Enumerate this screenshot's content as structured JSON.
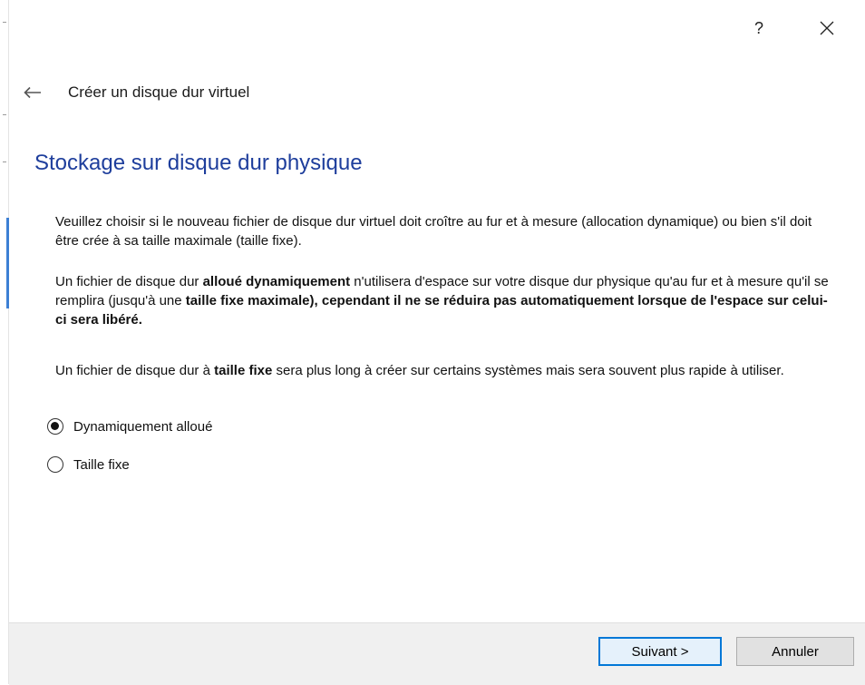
{
  "titlebar": {
    "help": "?",
    "close": "✕"
  },
  "wizard": {
    "title": "Créer un disque dur virtuel"
  },
  "page": {
    "title": "Stockage sur disque dur physique",
    "paragraph1": "Veuillez choisir si le nouveau fichier de disque dur virtuel doit croître au fur et à mesure (allocation dynamique) ou bien s'il doit être crée à sa taille maximale (taille fixe).",
    "paragraph2": {
      "part1": "Un fichier de disque dur ",
      "bold1": "alloué dynamiquement",
      "part2": " n'utilisera d'espace sur votre disque dur physique qu'au fur et à mesure qu'il se remplira (jusqu'à une ",
      "bold2": "taille fixe maximale), cependant il ne se réduira pas automatiquement lorsque de l'espace sur celui-ci sera libéré."
    },
    "paragraph3": {
      "part1": "Un fichier de disque dur à ",
      "bold1": "taille fixe",
      "part2": " sera plus long à créer sur certains systèmes mais sera souvent plus rapide à utiliser."
    }
  },
  "options": [
    {
      "label": "Dynamiquement alloué",
      "checked": true
    },
    {
      "label": "Taille fixe",
      "checked": false
    }
  ],
  "buttons": {
    "next": "Suivant >",
    "cancel": "Annuler"
  },
  "colors": {
    "title": "#1e3e9c",
    "accent": "#0078d7",
    "footer": "#f0f0f0"
  }
}
